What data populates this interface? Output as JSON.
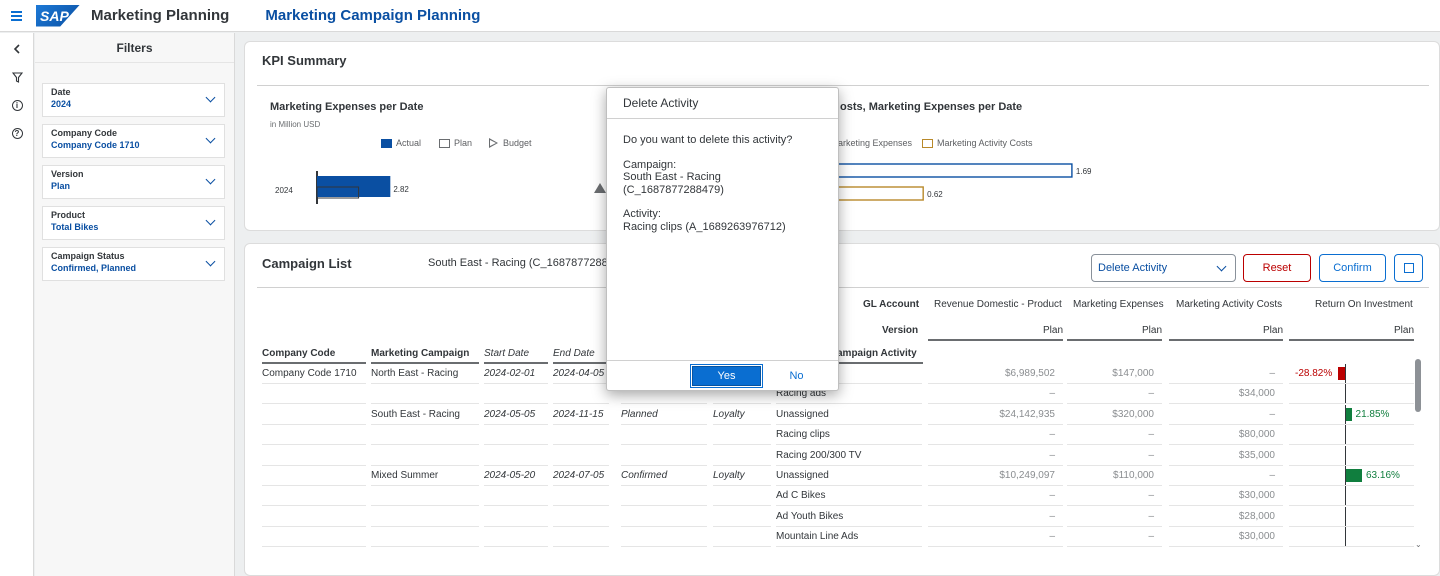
{
  "shell": {
    "logo": "SAP",
    "app_title": "Marketing Planning",
    "page_title": "Marketing Campaign Planning"
  },
  "rail": {
    "info": "i",
    "help": "?"
  },
  "filters": {
    "title": "Filters",
    "items": [
      {
        "label": "Date",
        "value": "2024"
      },
      {
        "label": "Company Code",
        "value": "Company Code 1710"
      },
      {
        "label": "Version",
        "value": "Plan"
      },
      {
        "label": "Product",
        "value": "Total Bikes"
      },
      {
        "label": "Campaign Status",
        "value": "Confirmed, Planned"
      }
    ]
  },
  "kpi": {
    "title": "KPI Summary",
    "chart1": {
      "title": "Marketing Expenses per Date",
      "subtitle": "in Million USD",
      "legend": [
        "Actual",
        "Plan",
        "Budget"
      ],
      "category": "2024",
      "value_label": "2.82"
    },
    "chart2": {
      "title_partial": "osts, Marketing Expenses per Date",
      "legend": [
        "arketing Expenses",
        "Marketing Activity Costs"
      ],
      "value_labels": [
        "1.69",
        "0.62"
      ]
    }
  },
  "chart_data": [
    {
      "type": "bar",
      "title": "Marketing Expenses per Date",
      "subtitle": "in Million USD",
      "categories": [
        "2024"
      ],
      "series": [
        {
          "name": "Actual",
          "values": [
            2.82
          ]
        },
        {
          "name": "Plan",
          "values": [
            1.6
          ]
        }
      ],
      "legend": [
        "Actual",
        "Plan",
        "Budget"
      ],
      "color_actual": "#0a4fa2"
    },
    {
      "type": "bar",
      "title": "osts, Marketing Expenses per Date",
      "series": [
        {
          "name": "arketing Expenses",
          "values": [
            1.69
          ]
        },
        {
          "name": "Marketing Activity Costs",
          "values": [
            0.62
          ]
        }
      ],
      "colors": [
        "#0a4fa2",
        "#b8892a"
      ]
    }
  ],
  "campaign": {
    "title": "Campaign List",
    "selected": "South East - Racing (C_16878772884",
    "select_value": "Delete Activity",
    "reset_label": "Reset",
    "confirm_label": "Confirm",
    "gl_account_label": "GL Account",
    "version_label": "Version",
    "measures": [
      "Revenue Domestic - Product",
      "Marketing Expenses",
      "Marketing Activity Costs",
      "Return On Investment"
    ],
    "versions": [
      "Plan",
      "Plan",
      "Plan",
      "Plan"
    ],
    "columns": [
      "Company Code",
      "Marketing Campaign",
      "Start Date",
      "End Date",
      "ampaign Activity"
    ],
    "rows": [
      {
        "company": "Company Code 1710",
        "campaign": "North East - Racing",
        "start": "2024-02-01",
        "end": "2024-04-05",
        "status": "",
        "type": "",
        "activity": "",
        "rev": "$6,989,502",
        "exp": "$147,000",
        "cost": "–",
        "roi": "-28.82%",
        "roi_val": -28.82
      },
      {
        "company": "",
        "campaign": "",
        "start": "",
        "end": "",
        "status": "",
        "type": "",
        "activity": "Racing ads",
        "rev": "–",
        "exp": "–",
        "cost": "$34,000",
        "roi": "",
        "roi_val": null
      },
      {
        "company": "",
        "campaign": "South East - Racing",
        "start": "2024-05-05",
        "end": "2024-11-15",
        "status": "Planned",
        "type": "Loyalty",
        "activity": "Unassigned",
        "rev": "$24,142,935",
        "exp": "$320,000",
        "cost": "–",
        "roi": "21.85%",
        "roi_val": 21.85
      },
      {
        "company": "",
        "campaign": "",
        "start": "",
        "end": "",
        "status": "",
        "type": "",
        "activity": "Racing clips",
        "rev": "–",
        "exp": "–",
        "cost": "$80,000",
        "roi": "",
        "roi_val": null
      },
      {
        "company": "",
        "campaign": "",
        "start": "",
        "end": "",
        "status": "",
        "type": "",
        "activity": "Racing 200/300 TV",
        "rev": "–",
        "exp": "–",
        "cost": "$35,000",
        "roi": "",
        "roi_val": null
      },
      {
        "company": "",
        "campaign": "Mixed Summer",
        "start": "2024-05-20",
        "end": "2024-07-05",
        "status": "Confirmed",
        "type": "Loyalty",
        "activity": "Unassigned",
        "rev": "$10,249,097",
        "exp": "$110,000",
        "cost": "–",
        "roi": "63.16%",
        "roi_val": 63.16
      },
      {
        "company": "",
        "campaign": "",
        "start": "",
        "end": "",
        "status": "",
        "type": "",
        "activity": "Ad C Bikes",
        "rev": "–",
        "exp": "–",
        "cost": "$30,000",
        "roi": "",
        "roi_val": null
      },
      {
        "company": "",
        "campaign": "",
        "start": "",
        "end": "",
        "status": "",
        "type": "",
        "activity": "Ad Youth Bikes",
        "rev": "–",
        "exp": "–",
        "cost": "$28,000",
        "roi": "",
        "roi_val": null
      },
      {
        "company": "",
        "campaign": "",
        "start": "",
        "end": "",
        "status": "",
        "type": "",
        "activity": "Mountain Line Ads",
        "rev": "–",
        "exp": "–",
        "cost": "$30,000",
        "roi": "",
        "roi_val": null
      }
    ],
    "roi_colors": {
      "negative": "#bb0000",
      "positive": "#107e3e"
    }
  },
  "dialog": {
    "title": "Delete Activity",
    "question": "Do you want to delete this activity?",
    "campaign_label": "Campaign:",
    "campaign_value": "South East - Racing (C_1687877288479)",
    "activity_label": "Activity:",
    "activity_value": "Racing clips (A_1689263976712)",
    "yes_label": "Yes",
    "no_label": "No"
  }
}
